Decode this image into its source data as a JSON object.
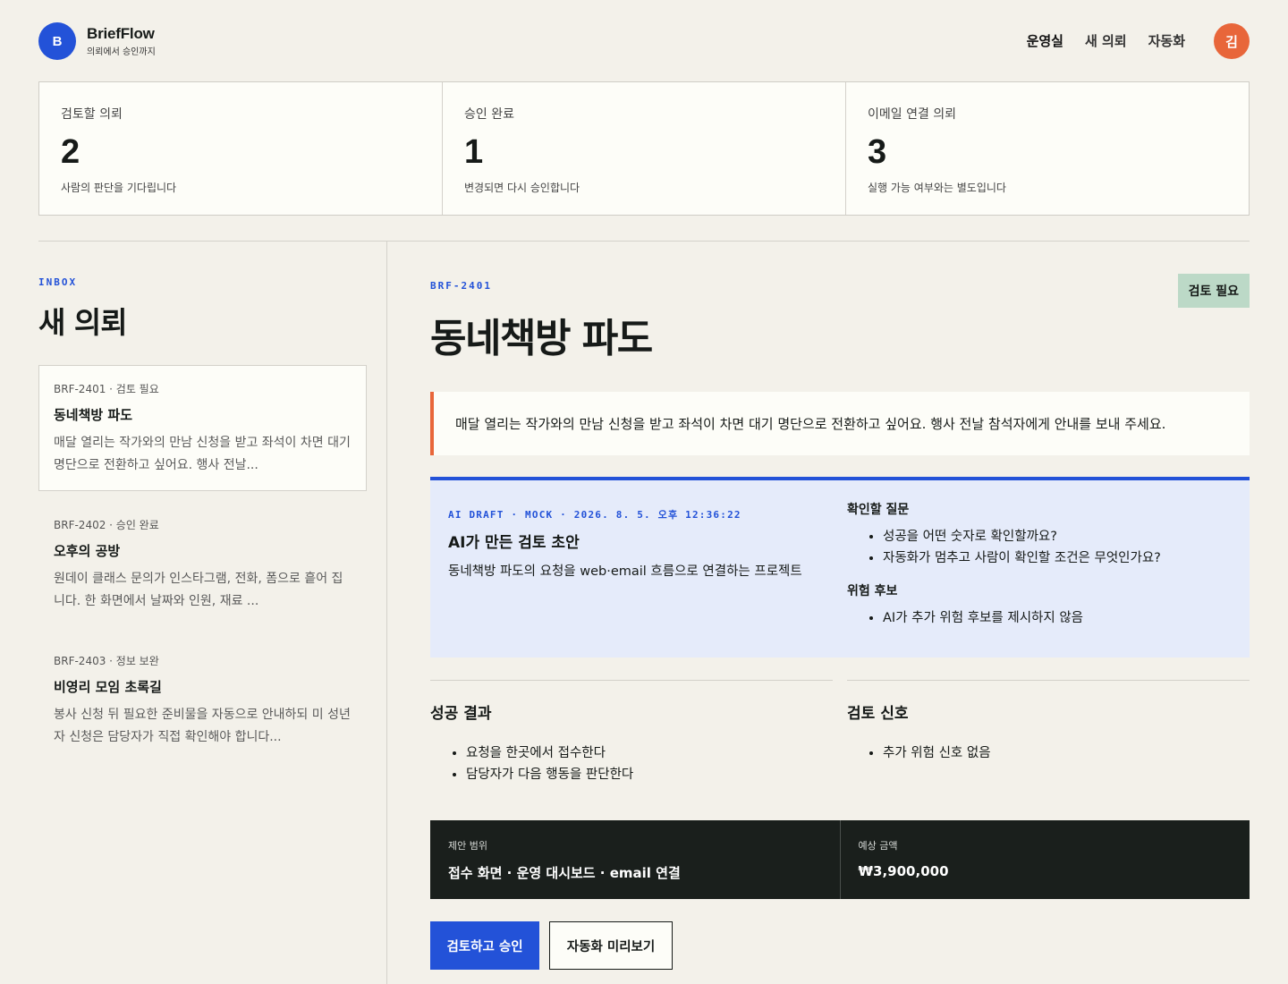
{
  "header": {
    "logo_letter": "B",
    "brand_name": "BriefFlow",
    "brand_tagline": "의뢰에서 승인까지",
    "nav": [
      "운영실",
      "새 의뢰",
      "자동화"
    ],
    "avatar_initial": "김"
  },
  "stats": [
    {
      "label": "검토할 의뢰",
      "value": "2",
      "note": "사람의 판단을 기다립니다"
    },
    {
      "label": "승인 완료",
      "value": "1",
      "note": "변경되면 다시 승인합니다"
    },
    {
      "label": "이메일 연결 의뢰",
      "value": "3",
      "note": "실행 가능 여부와는 별도입니다"
    }
  ],
  "inbox": {
    "eyebrow": "INBOX",
    "title": "새 의뢰",
    "items": [
      {
        "meta": "BRF-2401 · 검토 필요",
        "title": "동네책방 파도",
        "desc": "매달 열리는 작가와의 만남 신청을 받고 좌석이 차면 대기 명단으로 전환하고 싶어요. 행사 전날..."
      },
      {
        "meta": "BRF-2402 · 승인 완료",
        "title": "오후의 공방",
        "desc": "원데이 클래스 문의가 인스타그램, 전화, 폼으로 흩어 집니다. 한 화면에서 날짜와 인원, 재료 ..."
      },
      {
        "meta": "BRF-2403 · 정보 보완",
        "title": "비영리 모임 초록길",
        "desc": "봉사 신청 뒤 필요한 준비물을 자동으로 안내하되 미 성년자 신청은 담당자가 직접 확인해야 합니다..."
      }
    ]
  },
  "detail": {
    "id": "BRF-2401",
    "status": "검토 필요",
    "title": "동네책방 파도",
    "request": "매달 열리는 작가와의 만남 신청을 받고 좌석이 차면 대기 명단으로 전환하고 싶어요. 행사 전날 참석자에게 안내를 보내 주세요.",
    "draft": {
      "eyebrow": "AI DRAFT · MOCK · 2026. 8. 5. 오후 12:36:22",
      "title": "AI가 만든 검토 초안",
      "summary": "동네책방 파도의 요청을 web·email 흐름으로 연결하는 프로젝트",
      "questions_heading": "확인할 질문",
      "questions": [
        "성공을 어떤 숫자로 확인할까요?",
        "자동화가 멈추고 사람이 확인할 조건은 무엇인가요?"
      ],
      "risks_heading": "위험 후보",
      "risks": [
        "AI가 추가 위험 후보를 제시하지 않음"
      ]
    },
    "success": {
      "heading": "성공 결과",
      "items": [
        "요청을 한곳에서 접수한다",
        "담당자가 다음 행동을 판단한다"
      ]
    },
    "signals": {
      "heading": "검토 신호",
      "items": [
        "추가 위험 신호 없음"
      ]
    },
    "scope": {
      "label": "제안 범위",
      "value": "접수 화면 · 운영 대시보드 · email 연결"
    },
    "estimate": {
      "label": "예상 금액",
      "value": "₩3,900,000"
    },
    "actions": {
      "approve": "검토하고 승인",
      "preview": "자동화 미리보기"
    }
  },
  "colors": {
    "accent": "#2352d8",
    "orange": "#e8663a",
    "status_chip": "#bcd9c7",
    "dark_bar": "#1a1f1c"
  }
}
